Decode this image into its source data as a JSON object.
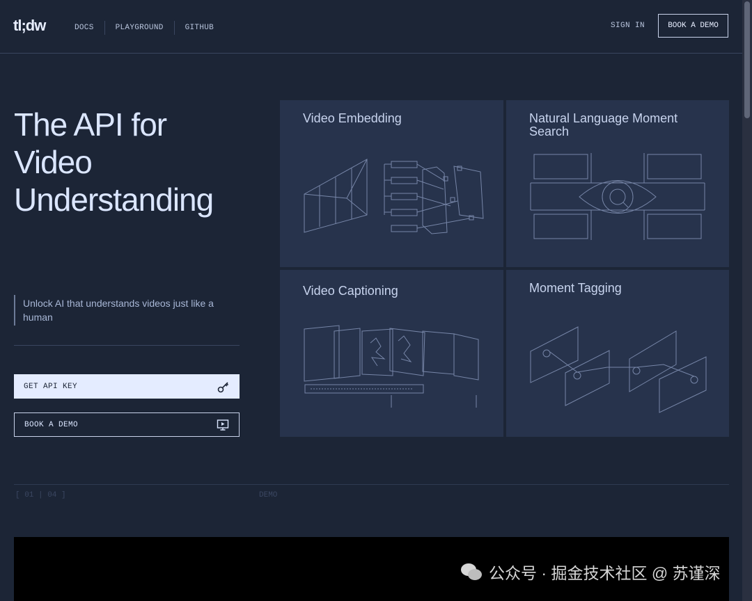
{
  "header": {
    "logo": "tl;dw",
    "nav": [
      "DOCS",
      "PLAYGROUND",
      "GITHUB"
    ],
    "sign_in": "SIGN IN",
    "book_demo": "BOOK A DEMO"
  },
  "hero": {
    "title_line1": "The API for",
    "title_line2": "Video",
    "title_line3": "Understanding",
    "subtitle": "Unlock AI that understands videos just like a human",
    "get_api_key": "GET API KEY",
    "book_demo": "BOOK A DEMO"
  },
  "cards": {
    "embedding": "Video Embedding",
    "search": "Natural Language Moment Search",
    "captioning": "Video Captioning",
    "tagging": "Moment Tagging"
  },
  "lower": {
    "counter": "[ 01 | 04 ]",
    "demo_label": "DEMO"
  },
  "watermark": {
    "text": "公众号 · 掘金技术社区 @ 苏谨深"
  },
  "icons": {
    "key": "key-icon",
    "demo": "screen-play-icon",
    "search": "magnifier-icon"
  },
  "colors": {
    "background": "#1c2536",
    "card": "#27334c",
    "primary_button": "#e4ecff"
  }
}
